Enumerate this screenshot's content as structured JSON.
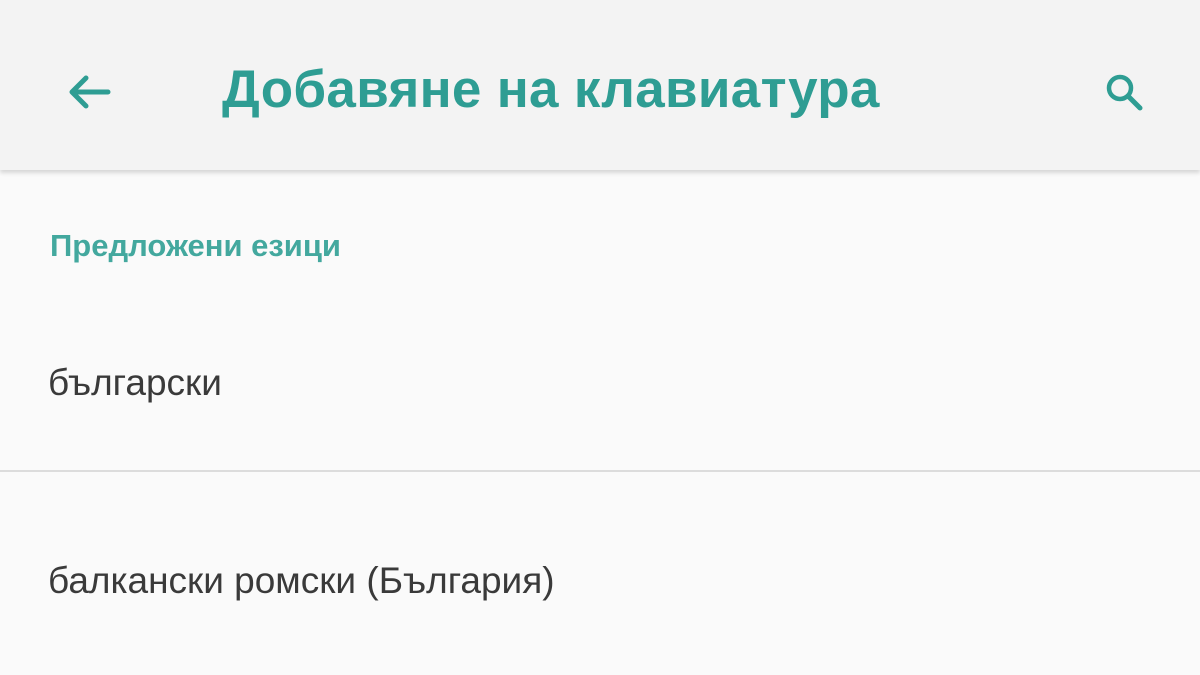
{
  "app_bar": {
    "title": "Добавяне на клавиатура",
    "back_icon": "arrow-back-icon",
    "search_icon": "search-icon",
    "accent_color": "#2e9d93"
  },
  "section": {
    "header": "Предложени езици"
  },
  "languages": [
    {
      "label": "български"
    },
    {
      "label": "балкански ромски (България)"
    }
  ]
}
